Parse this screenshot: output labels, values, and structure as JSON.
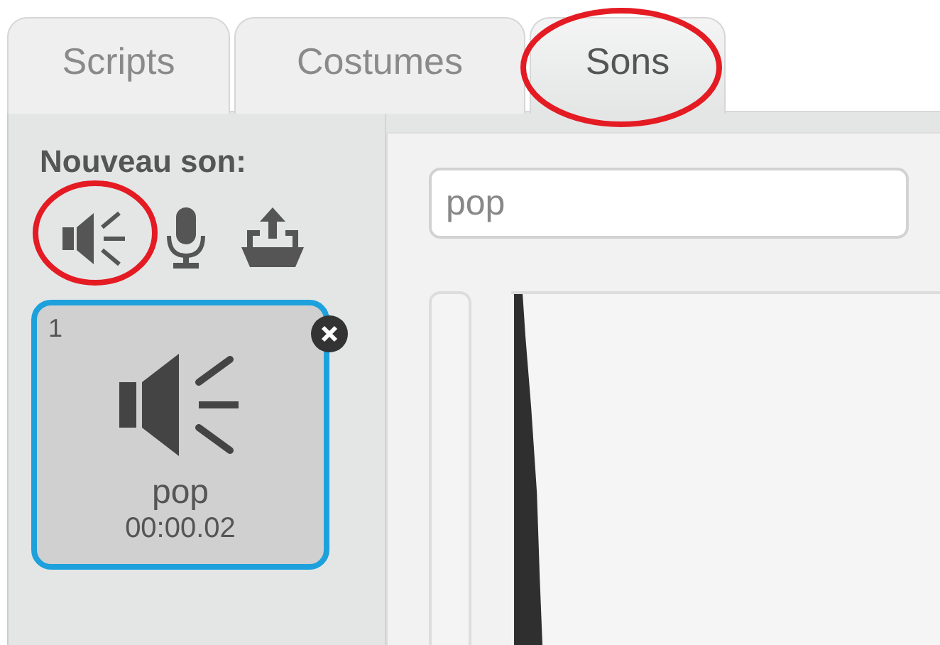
{
  "tabs": [
    {
      "label": "Scripts",
      "selected": false,
      "highlighted": false
    },
    {
      "label": "Costumes",
      "selected": false,
      "highlighted": false
    },
    {
      "label": "Sons",
      "selected": true,
      "highlighted": true
    }
  ],
  "new_sound": {
    "label": "Nouveau son:",
    "buttons": [
      {
        "kind": "library",
        "highlighted": true
      },
      {
        "kind": "record",
        "highlighted": false
      },
      {
        "kind": "upload",
        "highlighted": false
      }
    ]
  },
  "sounds": [
    {
      "number": "1",
      "name": "pop",
      "duration": "00:00.02",
      "selected": true
    }
  ],
  "editor": {
    "name_field": {
      "value": "pop"
    }
  }
}
